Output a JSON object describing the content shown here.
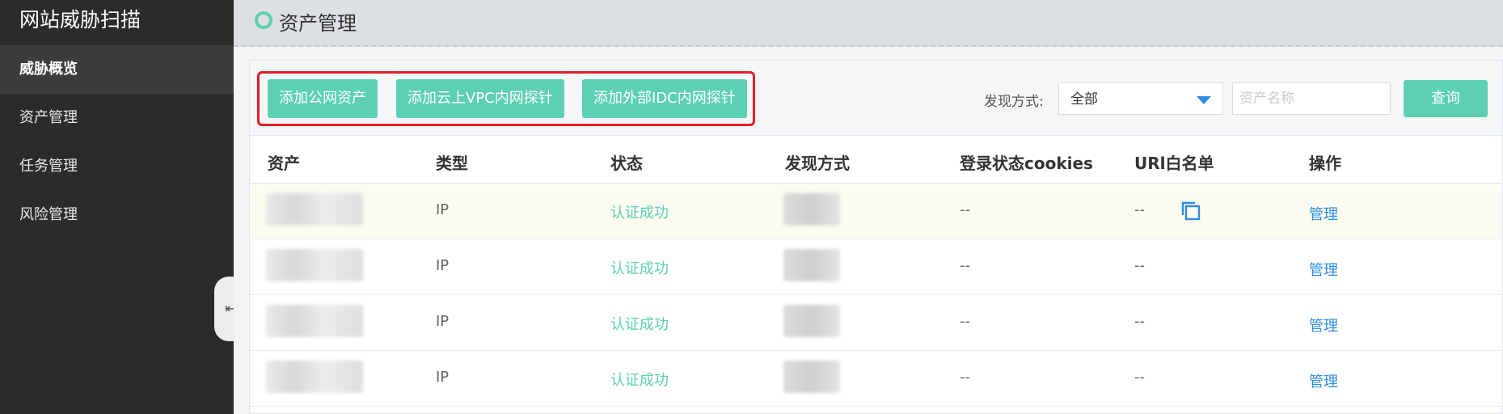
{
  "sidebar": {
    "brand": "网站威胁扫描",
    "items": [
      {
        "label": "威胁概览"
      },
      {
        "label": "资产管理"
      },
      {
        "label": "任务管理"
      },
      {
        "label": "风险管理"
      }
    ],
    "collapse_glyph": "⇤"
  },
  "header": {
    "title": "资产管理"
  },
  "toolbar": {
    "add_public_label": "添加公网资产",
    "add_vpc_label": "添加云上VPC内网探针",
    "add_idc_label": "添加外部IDC内网探针",
    "filter_label": "发现方式:",
    "filter_value": "全部",
    "search_placeholder": "资产名称",
    "query_label": "查询"
  },
  "table": {
    "headers": [
      "资产",
      "类型",
      "状态",
      "发现方式",
      "登录状态cookies",
      "URl白名单",
      "操作"
    ],
    "rows": [
      {
        "type": "IP",
        "status": "认证成功",
        "cookies": "--",
        "whitelist": "--",
        "action": "管理"
      },
      {
        "type": "IP",
        "status": "认证成功",
        "cookies": "--",
        "whitelist": "--",
        "action": "管理"
      },
      {
        "type": "IP",
        "status": "认证成功",
        "cookies": "--",
        "whitelist": "--",
        "action": "管理"
      },
      {
        "type": "IP",
        "status": "认证成功",
        "cookies": "--",
        "whitelist": "--",
        "action": "管理"
      }
    ]
  },
  "colors": {
    "accent_green": "#5dd0b3",
    "link_blue": "#2e8de0",
    "highlight_red": "#e0202a",
    "sidebar_bg": "#2b2b2b"
  },
  "icons": [
    "collapse-sidebar-icon",
    "title-dot-icon",
    "dropdown-arrow-icon",
    "copy-icon"
  ]
}
